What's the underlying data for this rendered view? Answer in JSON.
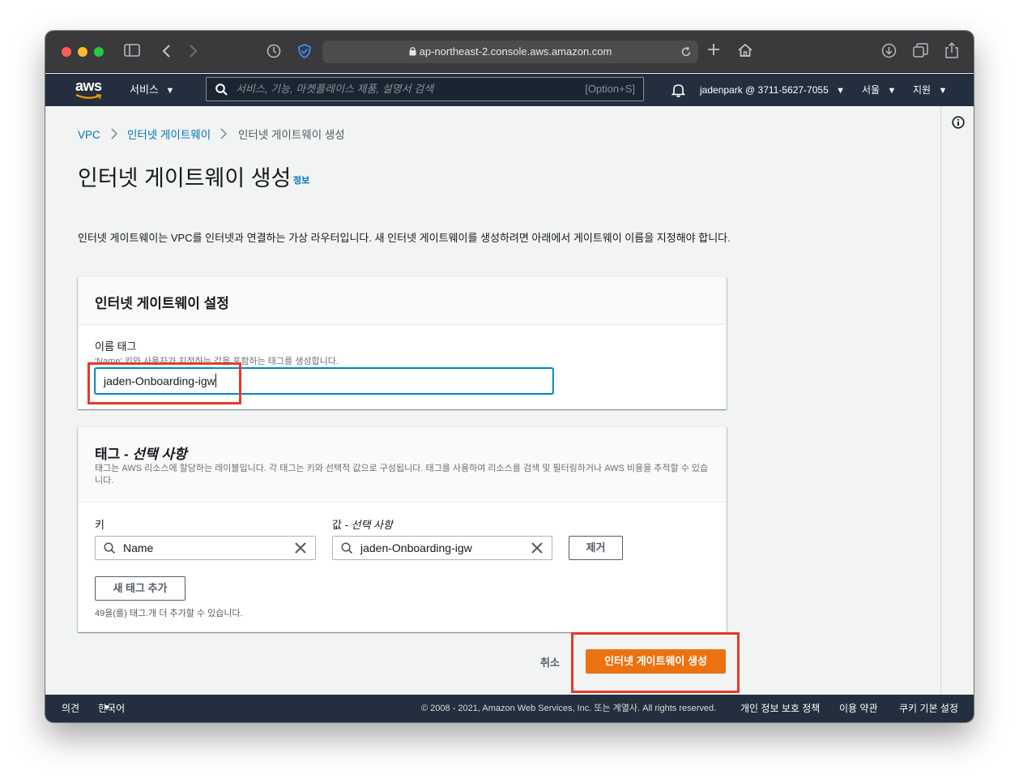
{
  "browser": {
    "url": "ap-northeast-2.console.aws.amazon.com",
    "traffic_colors": [
      "#ff5f57",
      "#febc2e",
      "#28c840"
    ]
  },
  "aws_nav": {
    "logo": "aws",
    "services_label": "서비스",
    "search_placeholder": "서비스, 기능, 마켓플레이스 제품, 설명서 검색",
    "search_shortcut": "[Option+S]",
    "account": "jadenpark @ 3711-5627-7055",
    "region": "서울",
    "support": "지원"
  },
  "breadcrumb": {
    "items": [
      "VPC",
      "인터넷 게이트웨이",
      "인터넷 게이트웨이 생성"
    ]
  },
  "page": {
    "title": "인터넷 게이트웨이 생성",
    "info_link": "정보",
    "description": "인터넷 게이트웨이는 VPC를 인터넷과 연결하는 가상 라우터입니다. 새 인터넷 게이트웨이를 생성하려면 아래에서 게이트웨이 이름을 지정해야 합니다."
  },
  "settings_panel": {
    "title": "인터넷 게이트웨이 설정",
    "name_tag_label": "이름 태그",
    "name_tag_hint": "'Name' 키와 사용자가 지정하는 값을 포함하는 태그를 생성합니다.",
    "name_tag_value": "jaden-Onboarding-igw"
  },
  "tags_panel": {
    "title_prefix": "태그 - ",
    "title_optional": "선택 사항",
    "description": "태그는 AWS 리소스에 할당하는 레이블입니다. 각 태그는 키와 선택적 값으로 구성됩니다. 태그를 사용하여 리소스를 검색 및 필터링하거나 AWS 비용을 추적할 수 있습니다.",
    "key_label": "키",
    "value_label_prefix": "값 - ",
    "value_label_optional": "선택 사항",
    "key_value": "Name",
    "value_value": "jaden-Onboarding-igw",
    "remove_button": "제거",
    "add_tag_button": "새 태그 추가",
    "remaining_hint": "49을(를) 태그.개 더 추가할 수 있습니다."
  },
  "actions": {
    "cancel": "취소",
    "create": "인터넷 게이트웨이 생성"
  },
  "footer": {
    "feedback": "의견",
    "language": "한국어",
    "copyright": "© 2008 - 2021, Amazon Web Services, Inc. 또는 계열사. All rights reserved.",
    "privacy": "개인 정보 보호 정책",
    "terms": "이용 약관",
    "cookies": "쿠키 기본 설정"
  },
  "colors": {
    "aws_nav_bg": "#232f3e",
    "link": "#0073bb",
    "primary": "#ec7211",
    "highlight_box": "#e8382b"
  }
}
